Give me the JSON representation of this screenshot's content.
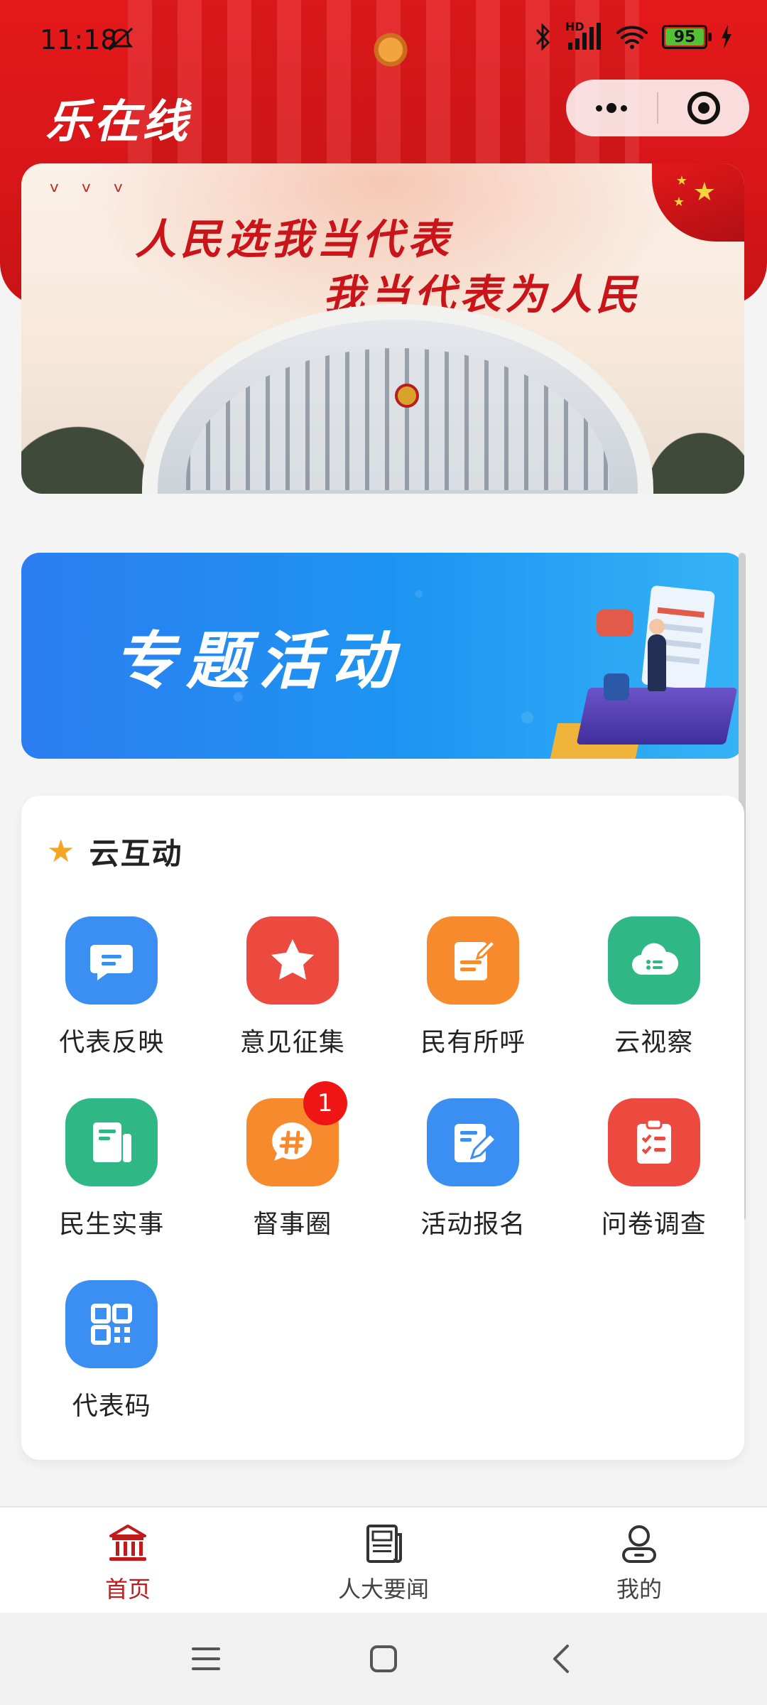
{
  "status_bar": {
    "time": "11:18",
    "battery": "95",
    "network_label": "HD"
  },
  "header": {
    "app_title": "乐在线"
  },
  "banner_main": {
    "slogan_line1": "人民选我当代表",
    "slogan_line2": "我当代表为人民"
  },
  "banner_topic": {
    "title": "专题活动"
  },
  "cloud_section": {
    "title": "云互动",
    "items": [
      {
        "label": "代表反映",
        "icon": "message-icon",
        "color": "#3b8ef2"
      },
      {
        "label": "意见征集",
        "icon": "star-icon",
        "color": "#ec4a3e"
      },
      {
        "label": "民有所呼",
        "icon": "edit-note-icon",
        "color": "#f78a2c"
      },
      {
        "label": "云视察",
        "icon": "cloud-list-icon",
        "color": "#2fb885"
      },
      {
        "label": "民生实事",
        "icon": "document-icon",
        "color": "#2fb885"
      },
      {
        "label": "督事圈",
        "icon": "hashtag-bubble-icon",
        "color": "#f78a2c",
        "badge": "1"
      },
      {
        "label": "活动报名",
        "icon": "signup-pen-icon",
        "color": "#3b8ef2"
      },
      {
        "label": "问卷调查",
        "icon": "clipboard-checklist-icon",
        "color": "#ec4a3e"
      },
      {
        "label": "代表码",
        "icon": "qr-code-icon",
        "color": "#3b8ef2"
      }
    ]
  },
  "tabbar": {
    "tabs": [
      {
        "label": "首页",
        "icon": "home-hall-icon",
        "active": true
      },
      {
        "label": "人大要闻",
        "icon": "newspaper-icon",
        "active": false
      },
      {
        "label": "我的",
        "icon": "person-icon",
        "active": false
      }
    ]
  },
  "colors": {
    "brand_red": "#d71619",
    "active_tab": "#c2191b",
    "badge_red": "#f01515"
  }
}
